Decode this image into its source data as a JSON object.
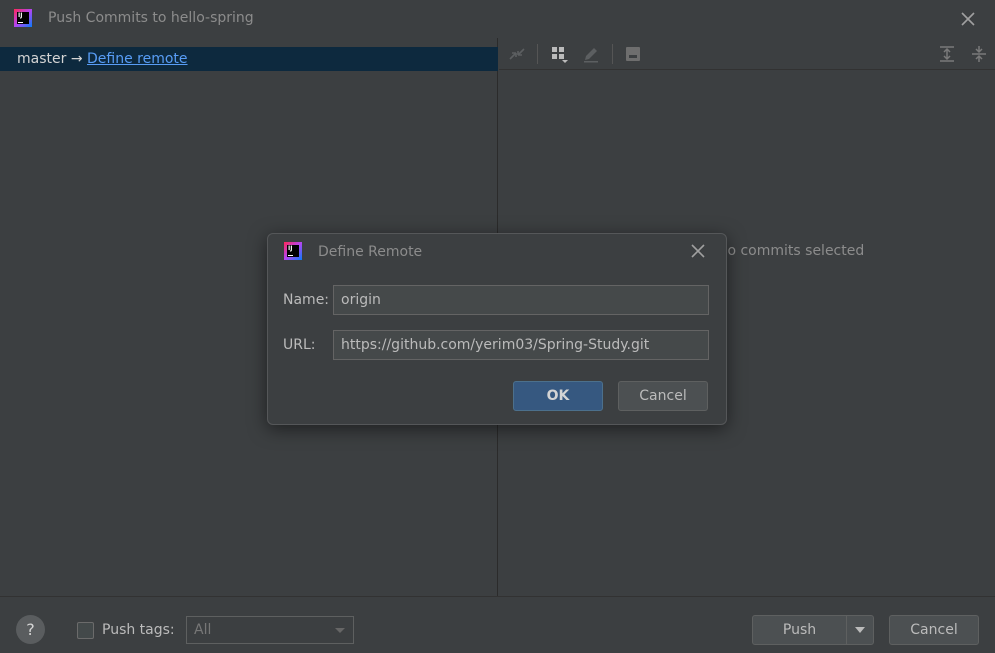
{
  "window": {
    "title": "Push Commits to hello-spring"
  },
  "tree": {
    "branch": "master",
    "arrow": "→",
    "define_remote_link": "Define remote"
  },
  "right_pane": {
    "empty_text": "No commits selected"
  },
  "bottom": {
    "help_label": "?",
    "push_tags_label": "Push tags:",
    "push_tags_value": "All",
    "push_label": "Push",
    "cancel_label": "Cancel"
  },
  "define_remote_dialog": {
    "title": "Define Remote",
    "name_label": "Name:",
    "name_value": "origin",
    "url_label": "URL:",
    "url_value": "https://github.com/yerim03/Spring-Study.git",
    "ok_label": "OK",
    "cancel_label": "Cancel"
  },
  "colors": {
    "background": "#3c3f41",
    "selection": "#0d293e",
    "link": "#589df6",
    "primary_button": "#365880"
  },
  "icons": [
    "app-logo-icon",
    "close-icon",
    "diff-icon",
    "group-by-icon",
    "edit-icon",
    "save-icon",
    "expand-all-icon",
    "collapse-all-icon",
    "caret-down-icon"
  ]
}
